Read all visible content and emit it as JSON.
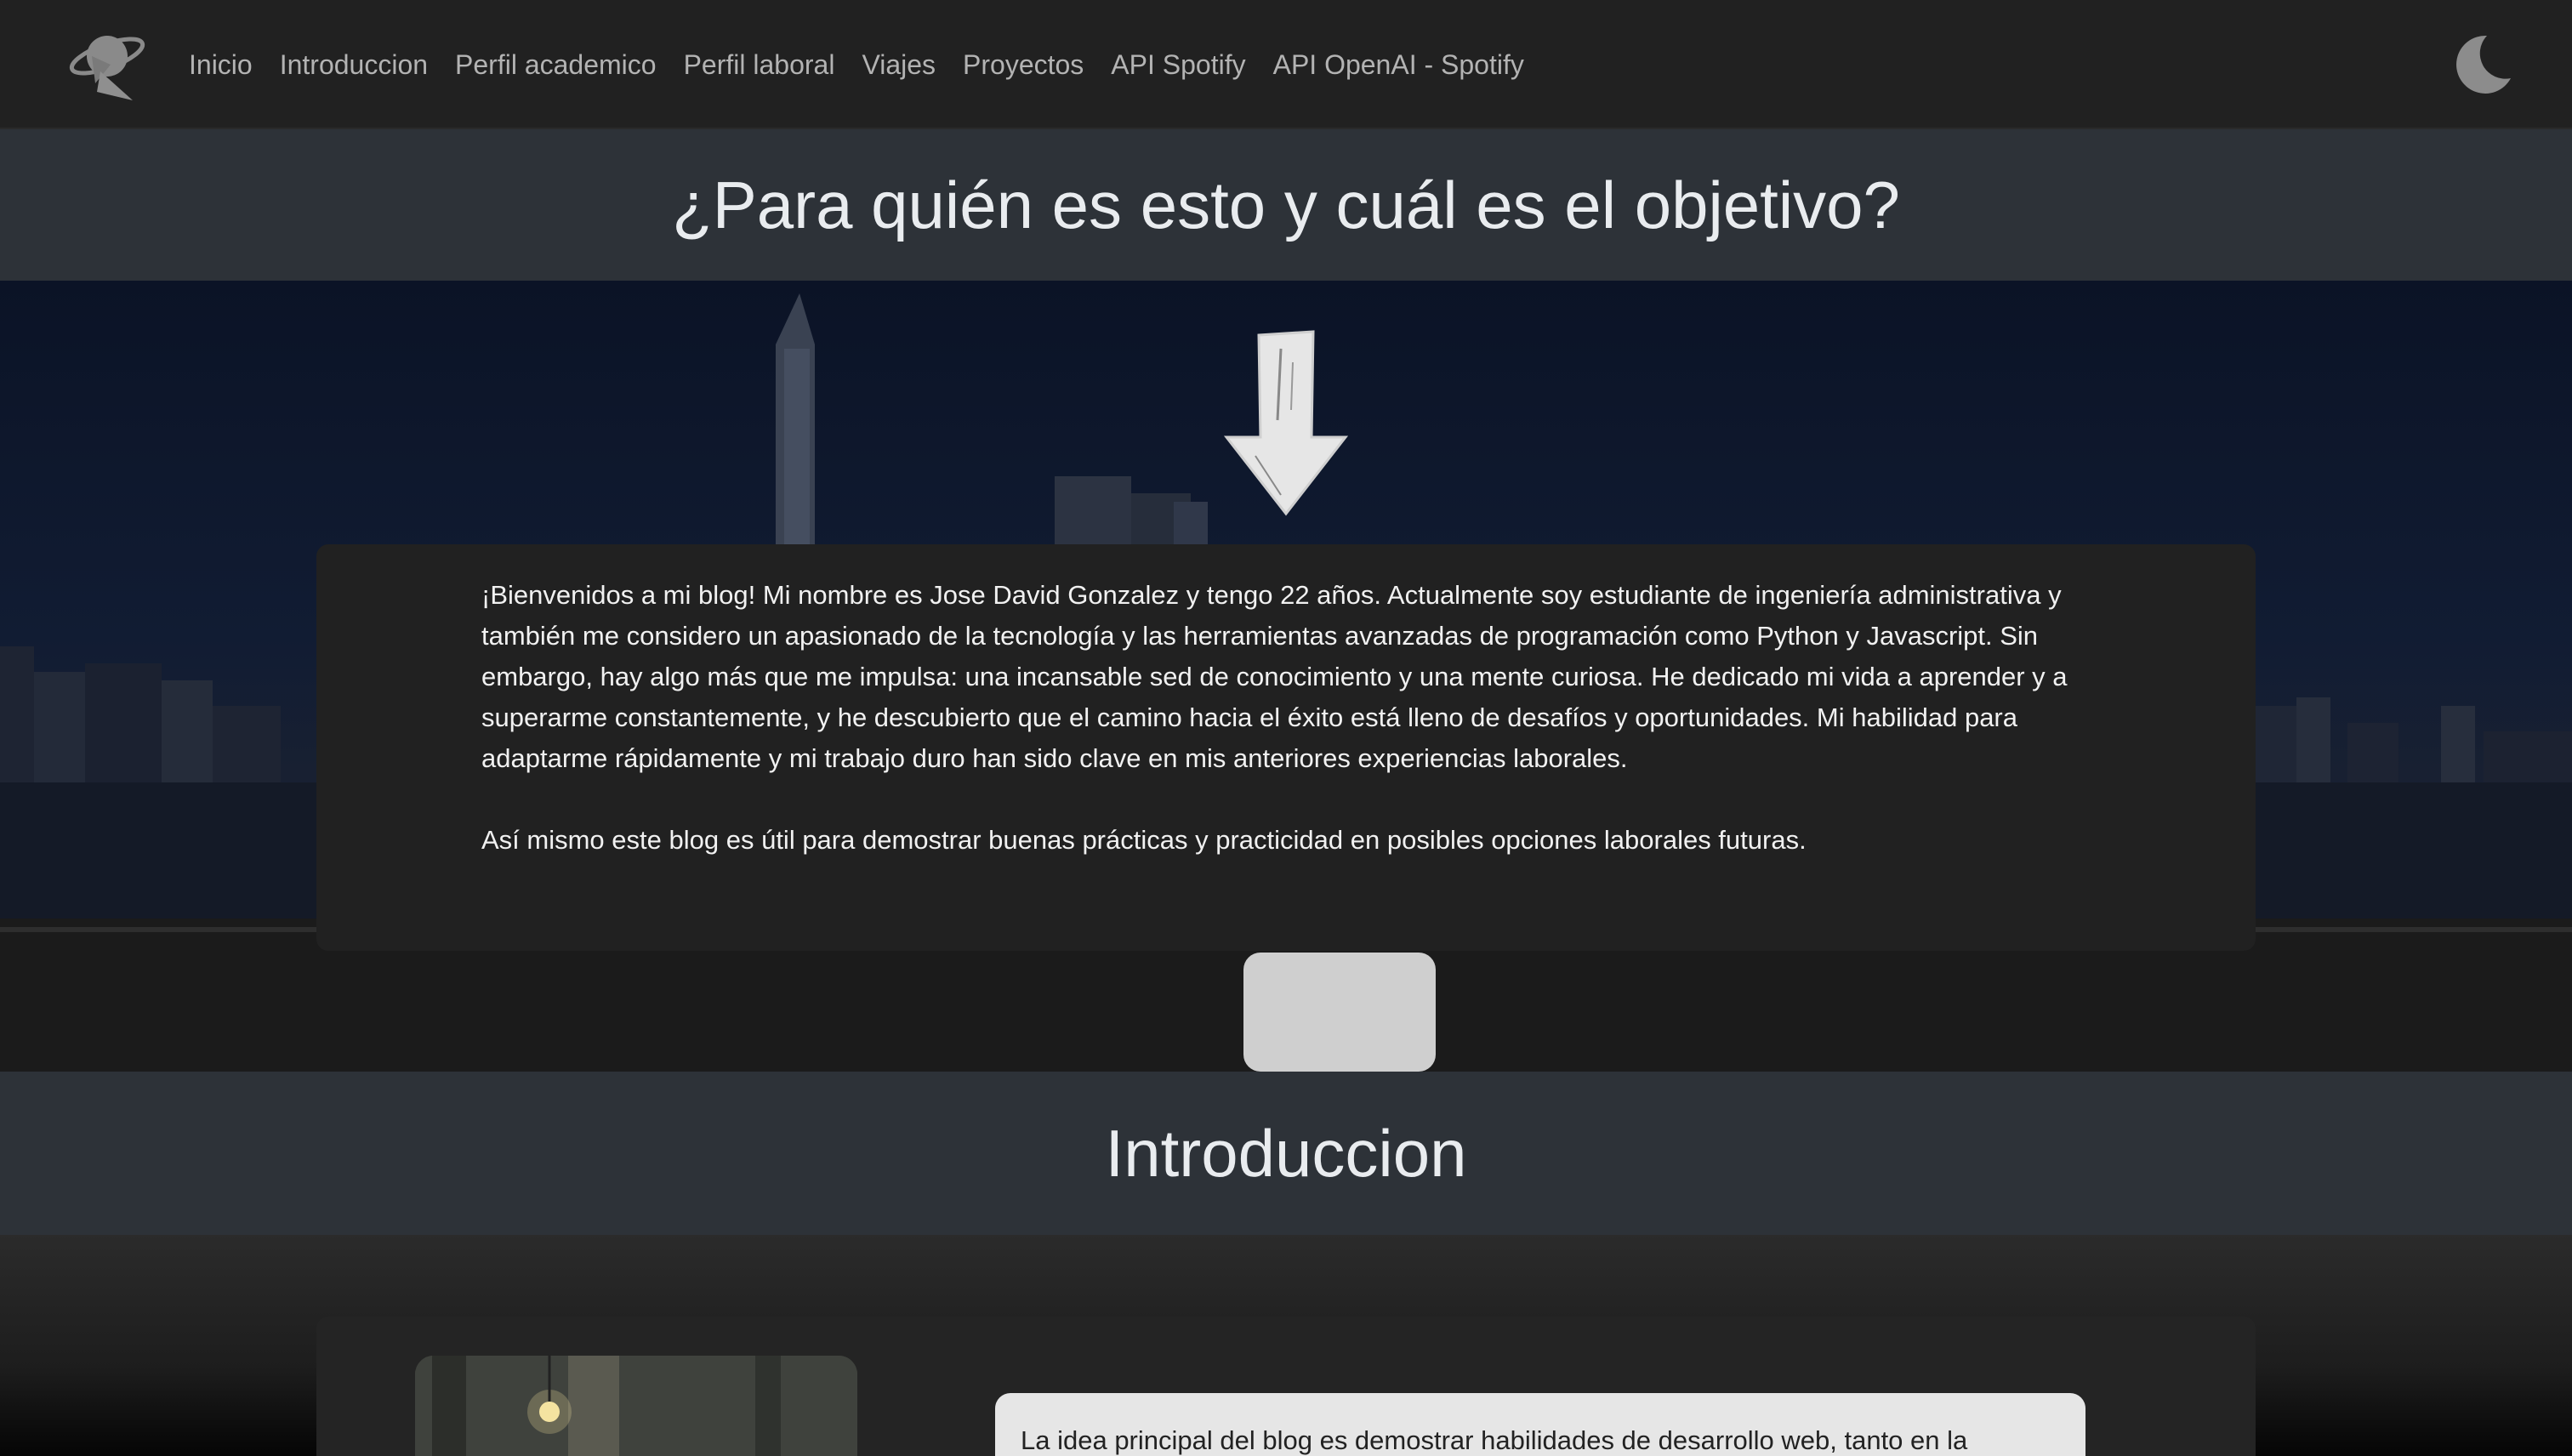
{
  "nav": {
    "items": [
      {
        "label": "Inicio"
      },
      {
        "label": "Introduccion"
      },
      {
        "label": "Perfil academico"
      },
      {
        "label": "Perfil laboral"
      },
      {
        "label": "Viajes"
      },
      {
        "label": "Proyectos"
      },
      {
        "label": "API Spotify"
      },
      {
        "label": "API OpenAI - Spotify"
      }
    ],
    "brand_icon": "globe-with-pointer-logo",
    "theme_icon": "moon-icon"
  },
  "purpose": {
    "title": "¿Para quién es esto y cuál es el objetivo?",
    "arrow_icon": "arrow-down-icon",
    "paragraph_1": "¡Bienvenidos a mi blog! Mi nombre es Jose David Gonzalez y tengo 22 años. Actualmente soy estudiante de ingeniería administrativa y también me considero un apasionado de la tecnología y las herramientas avanzadas de programación como Python y Javascript. Sin embargo, hay algo más que me impulsa: una incansable sed de conocimiento y una mente curiosa. He dedicado mi vida a aprender y a superarme constantemente, y he descubierto que el camino hacia el éxito está lleno de desafíos y oportunidades. Mi habilidad para adaptarme rápidamente y mi trabajo duro han sido clave en mis anteriores experiencias laborales.",
    "paragraph_2": "Así mismo este blog es útil para demostrar buenas prácticas y practicidad en posibles opciones laborales futuras."
  },
  "intro": {
    "title": "Introduccion",
    "text": "La idea principal del blog es demostrar habilidades de desarrollo web, tanto en la"
  },
  "colors": {
    "navbar_bg": "#212121",
    "section_head_bg": "#2d3238",
    "card_bg": "#212121",
    "intro_text_bg": "#e6e6e6"
  }
}
